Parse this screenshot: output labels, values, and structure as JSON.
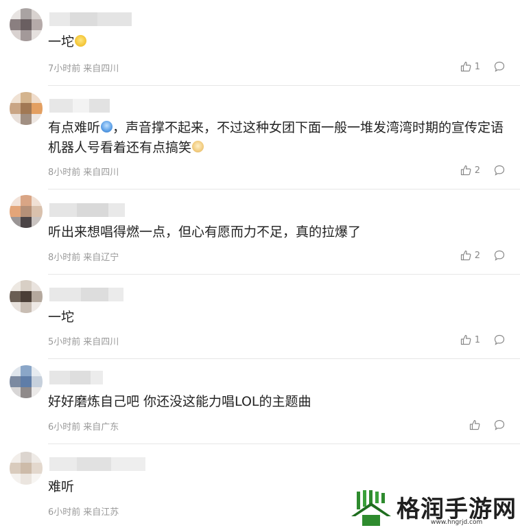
{
  "comments": [
    {
      "text": "一坨",
      "emoji": "sad-face-emoji",
      "time": "7小时前",
      "location": "来自四川",
      "likes": "1",
      "avatar_colors": [
        "#e8e4e2",
        "#a9a3a2",
        "#d8d2cf",
        "#8a7f80",
        "#6a5f61",
        "#b5aaa9",
        "#d9d2d0",
        "#a39999",
        "#e5e0de"
      ]
    },
    {
      "text": "有点难听",
      "emoji": "crying-emoji",
      "text_after_emoji": "，声音撑不起来，不过这种女团下面一般一堆发湾湾时期的宣传定语机器人号看着还有点搞笑",
      "emoji2": "laughing-dog-emoji",
      "time": "8小时前",
      "location": "来自四川",
      "likes": "2",
      "avatar_colors": [
        "#f0e2d4",
        "#d4b48e",
        "#efdccb",
        "#c9a585",
        "#a17854",
        "#e39f61",
        "#e8dfd9",
        "#a18f82",
        "#ede6e1"
      ]
    },
    {
      "text": "听出来想唱得燃一点，但心有愿而力不足，真的拉爆了",
      "time": "8小时前",
      "location": "来自辽宁",
      "likes": "2",
      "avatar_colors": [
        "#f2e2d8",
        "#d9a585",
        "#f0e0d4",
        "#e3a579",
        "#b59078",
        "#d9c1ad",
        "#9a9595",
        "#4b4446",
        "#c9c3c0"
      ]
    },
    {
      "text": "一坨",
      "time": "5小时前",
      "location": "来自四川",
      "likes": "1",
      "avatar_colors": [
        "#ede8e2",
        "#d8cfc5",
        "#e9e3de",
        "#6a5e54",
        "#4a3e36",
        "#b4a89d",
        "#e8e2dd",
        "#c8bdb3",
        "#eee9e5"
      ]
    },
    {
      "text": "好好磨炼自己吧 你还没这能力唱LOL的主题曲",
      "time": "6小时前",
      "location": "来自广东",
      "likes": "",
      "avatar_colors": [
        "#dfe5ec",
        "#8aa6c8",
        "#e6ebf0",
        "#7c8aa1",
        "#5f7da8",
        "#c6d0dc",
        "#d8d6d6",
        "#8f8a8a",
        "#ebe9e8"
      ]
    },
    {
      "text": "难听",
      "time": "6小时前",
      "location": "来自江苏",
      "likes": "",
      "avatar_colors": [
        "#f2eeea",
        "#dcd5cf",
        "#eeeae6",
        "#d9cbbd",
        "#cdbba9",
        "#e3d8cd",
        "#f4f1ee",
        "#ebe5df",
        "#f7f5f2"
      ]
    }
  ],
  "watermark": {
    "title": "格润手游网",
    "url": "www.hngrjd.com"
  },
  "colors": {
    "meta": "#999999",
    "divider": "#e6e6e6",
    "logo_green": "#2e8b2e"
  }
}
